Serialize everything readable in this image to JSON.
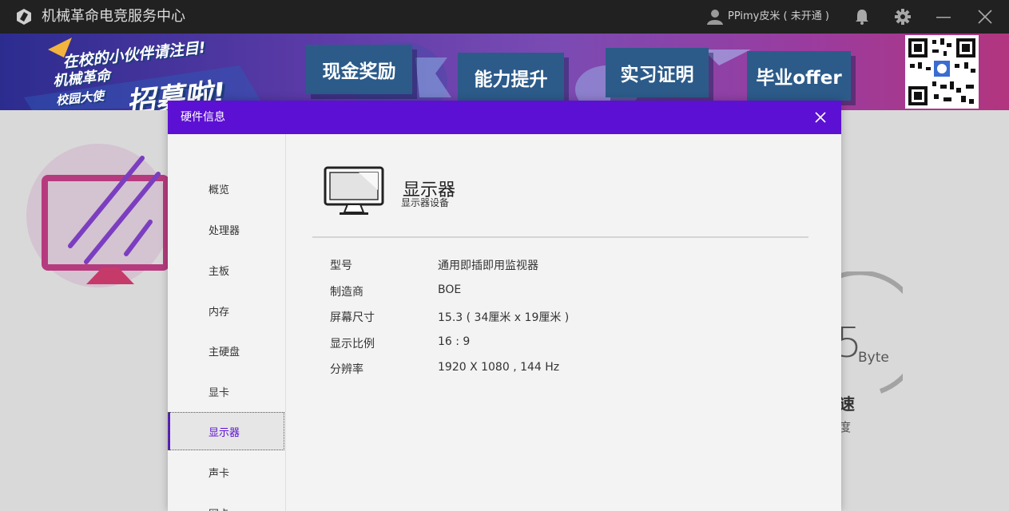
{
  "titlebar": {
    "app_title": "机械革命电竞服务中心",
    "user_name": "PPimy皮米 ( 未开通 )",
    "icons": [
      "app-logo-icon",
      "user-icon",
      "bell-icon",
      "gear-icon",
      "minimize-icon",
      "close-icon"
    ]
  },
  "banner": {
    "promo_line1": "在校的小伙伴请注目!",
    "promo_line2": "机械革命",
    "promo_line3": "校园大使",
    "promo_big": "招募啦!",
    "tags": [
      "现金奖励",
      "能力提升",
      "实习证明",
      "毕业offer"
    ]
  },
  "background": {
    "digit": "5",
    "unit": "Byte",
    "text_a": "速",
    "text_b": "度"
  },
  "dialog": {
    "title": "硬件信息",
    "nav": [
      {
        "label": "概览"
      },
      {
        "label": "处理器"
      },
      {
        "label": "主板"
      },
      {
        "label": "内存"
      },
      {
        "label": "主硬盘"
      },
      {
        "label": "显卡"
      },
      {
        "label": "显示器"
      },
      {
        "label": "声卡"
      },
      {
        "label": "网卡"
      }
    ],
    "active_nav": "显示器",
    "device": {
      "name": "显示器",
      "subtitle": "显示器设备"
    },
    "specs": [
      {
        "label": "型号",
        "value": "通用即插即用监视器"
      },
      {
        "label": "制造商",
        "value": "BOE"
      },
      {
        "label": "屏幕尺寸",
        "value": "15.3 ( 34厘米 x 19厘米 )"
      },
      {
        "label": "显示比例",
        "value": "16 : 9"
      },
      {
        "label": "分辨率",
        "value": "1920 X 1080 , 144 Hz"
      }
    ]
  },
  "colors": {
    "accent": "#5c10d3",
    "titlebar": "#212121",
    "dialog_bg": "#f3f3f3"
  }
}
